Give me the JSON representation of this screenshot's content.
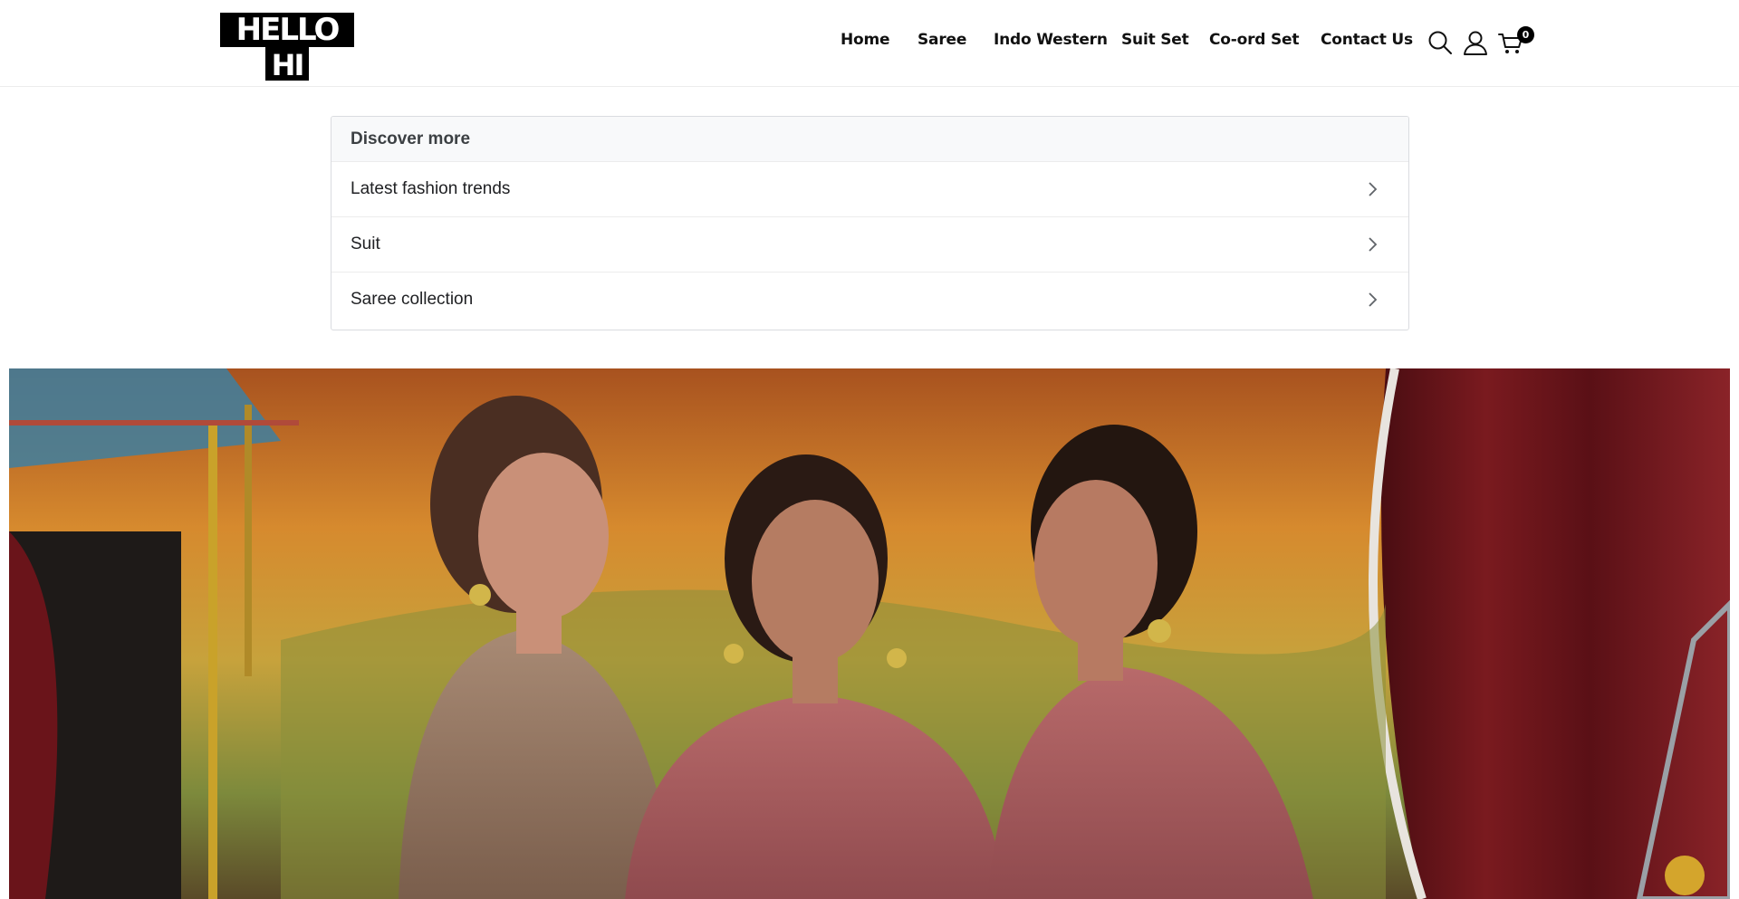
{
  "brand": {
    "logo_text_line1": "HELLO",
    "logo_text_line2": "HI"
  },
  "nav": {
    "items": [
      {
        "label": "Home"
      },
      {
        "label": "Saree"
      },
      {
        "label": "Indo Western"
      },
      {
        "label": "Suit Set"
      },
      {
        "label": "Co-ord Set"
      },
      {
        "label": "Contact Us"
      }
    ],
    "icons": [
      "search-icon",
      "user-icon",
      "cart-icon"
    ],
    "cart_count": "0"
  },
  "discover": {
    "title": "Discover more",
    "items": [
      {
        "label": "Latest fashion trends"
      },
      {
        "label": "Suit"
      },
      {
        "label": "Saree collection"
      }
    ]
  },
  "hero": {
    "description": "",
    "colors": {
      "warm_top": "#b8682a",
      "mid": "#d99a36",
      "green": "#7f8a3a"
    }
  }
}
